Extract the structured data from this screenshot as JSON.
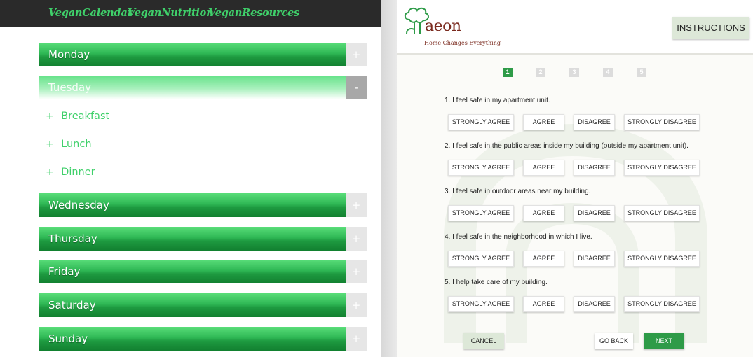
{
  "left": {
    "nav": [
      "VeganCalendar",
      "VeganNutrition",
      "VeganResources"
    ],
    "days": [
      {
        "label": "Monday",
        "toggle": "+"
      },
      {
        "label": "Tuesday",
        "toggle": "-"
      },
      {
        "label": "Wednesday",
        "toggle": "+"
      },
      {
        "label": "Thursday",
        "toggle": "+"
      },
      {
        "label": "Friday",
        "toggle": "+"
      },
      {
        "label": "Saturday",
        "toggle": "+"
      },
      {
        "label": "Sunday",
        "toggle": "+"
      }
    ],
    "meals": [
      {
        "plus": "+",
        "label": "Breakfast"
      },
      {
        "plus": "+",
        "label": "Lunch"
      },
      {
        "plus": "+",
        "label": "Dinner"
      }
    ],
    "colors": {
      "accent": "#3fd06a",
      "bar": "#1e9a40",
      "nav_bg": "#2a2a2a"
    }
  },
  "right": {
    "logo": {
      "name": "aeon",
      "tagline": "Home Changes Everything"
    },
    "instructions_label": "INSTRUCTIONS",
    "steps": [
      {
        "label": "1",
        "active": true
      },
      {
        "label": "2",
        "active": false
      },
      {
        "label": "3",
        "active": false
      },
      {
        "label": "4",
        "active": false
      },
      {
        "label": "5",
        "active": false
      }
    ],
    "questions": [
      {
        "text": "1. I feel safe in my apartment unit."
      },
      {
        "text": "2. I feel safe in the public areas inside my building (outside my apartment unit)."
      },
      {
        "text": "3. I feel safe in outdoor areas near my building."
      },
      {
        "text": "4. I feel safe in the neighborhood in which I live."
      },
      {
        "text": "5. I help take care of my building."
      }
    ],
    "options": [
      "STRONGLY AGREE",
      "AGREE",
      "DISAGREE",
      "STRONGLY DISAGREE"
    ],
    "buttons": {
      "cancel": "CANCEL",
      "back": "GO BACK",
      "next": "NEXT"
    },
    "colors": {
      "primary": "#2e9b48",
      "soft": "#dde8d8",
      "brand": "#7a2a1e"
    }
  }
}
